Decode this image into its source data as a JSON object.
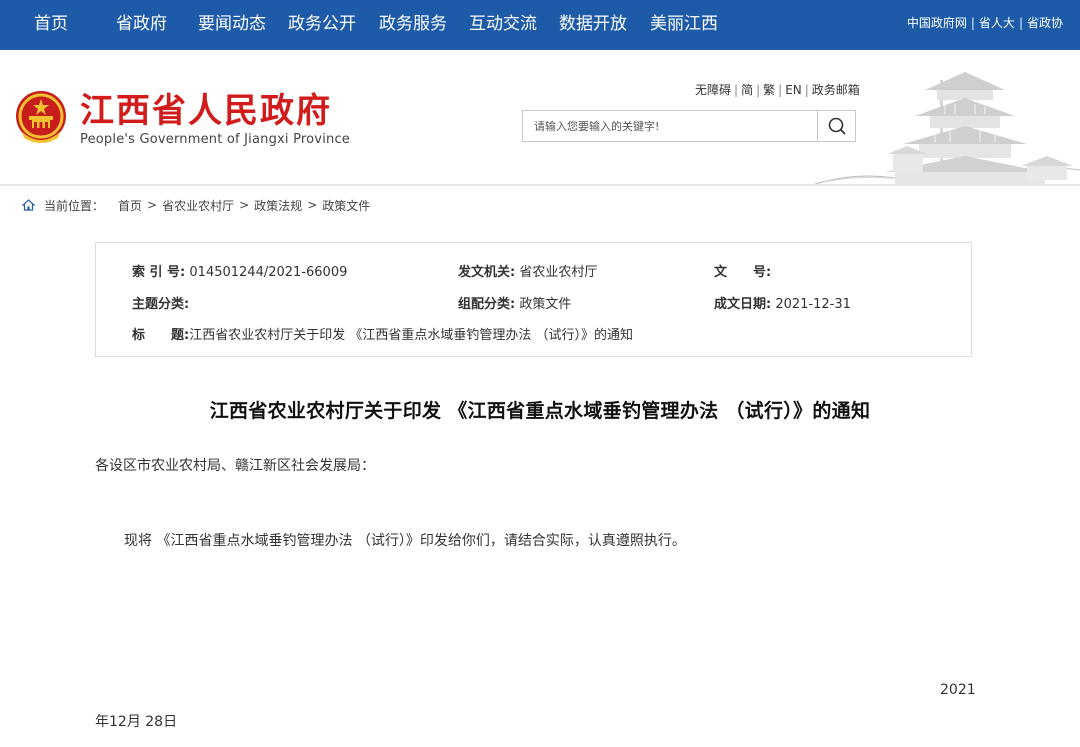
{
  "nav": {
    "items": [
      "首页",
      "省政府",
      "要闻动态",
      "政务公开",
      "政务服务",
      "互动交流",
      "数据开放",
      "美丽江西"
    ],
    "links": [
      "中国政府网",
      "省人大",
      "省政协"
    ]
  },
  "header": {
    "title": "江西省人民政府",
    "subtitle": "People's Government of Jiangxi Province",
    "util_links": [
      "无障碍",
      "简",
      "繁",
      "EN",
      "政务邮箱"
    ],
    "search_placeholder": "请输入您要输入的关键字!"
  },
  "breadcrumb": {
    "label": "当前位置：",
    "items": [
      "首页",
      "省农业农村厅",
      "政策法规",
      "政策文件"
    ],
    "separator": ">"
  },
  "info": {
    "index_label": "索 引 号:",
    "index_value": "014501244/2021-66009",
    "issuer_label": "发文机关:",
    "issuer_value": "省农业农村厅",
    "docno_label": "文　　号:",
    "docno_value": "",
    "topic_label": "主题分类:",
    "topic_value": "",
    "category_label": "组配分类:",
    "category_value": "政策文件",
    "date_label": "成文日期:",
    "date_value": "2021-12-31",
    "title_label": "标　　题:",
    "title_value": "江西省农业农村厅关于印发 《江西省重点水域垂钓管理办法 （试行）》的通知"
  },
  "article": {
    "title": "江西省农业农村厅关于印发 《江西省重点水域垂钓管理办法 （试行）》的通知",
    "salutation": "各设区市农业农村局、赣江新区社会发展局：",
    "body": "现将 《江西省重点水域垂钓管理办法 （试行）》印发给你们，请结合实际，认真遵照执行。",
    "date_year": "2021",
    "date_rest": "年12月 28日"
  },
  "colors": {
    "nav_bg": "#1d5ba8",
    "title_red": "#d21c1c"
  },
  "icons": {
    "search": "search-icon",
    "home": "home-icon",
    "emblem": "national-emblem-icon",
    "tower": "tengwang-pavilion-illustration"
  }
}
